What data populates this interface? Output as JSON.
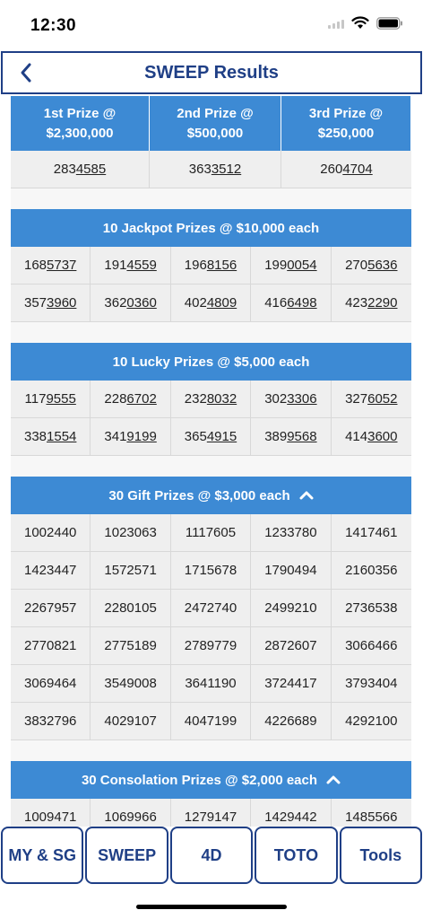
{
  "status_bar": {
    "time": "12:30"
  },
  "header": {
    "title": "SWEEP Results",
    "back_icon": "chevron-left-icon"
  },
  "top_prizes": [
    {
      "label_line1": "1st Prize @",
      "label_line2": "$2,300,000",
      "number_prefix": "283",
      "number_suffix": "4585"
    },
    {
      "label_line1": "2nd Prize @",
      "label_line2": "$500,000",
      "number_prefix": "363",
      "number_suffix": "3512"
    },
    {
      "label_line1": "3rd Prize @",
      "label_line2": "$250,000",
      "number_prefix": "260",
      "number_suffix": "4704"
    }
  ],
  "sections": [
    {
      "title": "10 Jackpot Prizes @ $10,000 each",
      "collapsible": false,
      "numbers": [
        [
          "168",
          "5737"
        ],
        [
          "191",
          "4559"
        ],
        [
          "196",
          "8156"
        ],
        [
          "199",
          "0054"
        ],
        [
          "270",
          "5636"
        ],
        [
          "357",
          "3960"
        ],
        [
          "362",
          "0360"
        ],
        [
          "402",
          "4809"
        ],
        [
          "416",
          "6498"
        ],
        [
          "423",
          "2290"
        ]
      ]
    },
    {
      "title": "10 Lucky Prizes @ $5,000 each",
      "collapsible": false,
      "numbers": [
        [
          "117",
          "9555"
        ],
        [
          "228",
          "6702"
        ],
        [
          "232",
          "8032"
        ],
        [
          "302",
          "3306"
        ],
        [
          "327",
          "6052"
        ],
        [
          "338",
          "1554"
        ],
        [
          "341",
          "9199"
        ],
        [
          "365",
          "4915"
        ],
        [
          "389",
          "9568"
        ],
        [
          "414",
          "3600"
        ]
      ]
    },
    {
      "title": "30 Gift Prizes @ $3,000 each",
      "collapsible": true,
      "numbers": [
        [
          "1002440",
          ""
        ],
        [
          "1023063",
          ""
        ],
        [
          "1117605",
          ""
        ],
        [
          "1233780",
          ""
        ],
        [
          "1417461",
          ""
        ],
        [
          "1423447",
          ""
        ],
        [
          "1572571",
          ""
        ],
        [
          "1715678",
          ""
        ],
        [
          "1790494",
          ""
        ],
        [
          "2160356",
          ""
        ],
        [
          "2267957",
          ""
        ],
        [
          "2280105",
          ""
        ],
        [
          "2472740",
          ""
        ],
        [
          "2499210",
          ""
        ],
        [
          "2736538",
          ""
        ],
        [
          "2770821",
          ""
        ],
        [
          "2775189",
          ""
        ],
        [
          "2789779",
          ""
        ],
        [
          "2872607",
          ""
        ],
        [
          "3066466",
          ""
        ],
        [
          "3069464",
          ""
        ],
        [
          "3549008",
          ""
        ],
        [
          "3641190",
          ""
        ],
        [
          "3724417",
          ""
        ],
        [
          "3793404",
          ""
        ],
        [
          "3832796",
          ""
        ],
        [
          "4029107",
          ""
        ],
        [
          "4047199",
          ""
        ],
        [
          "4226689",
          ""
        ],
        [
          "4292100",
          ""
        ]
      ]
    },
    {
      "title": "30 Consolation Prizes @ $2,000 each",
      "collapsible": true,
      "numbers": [
        [
          "1009471",
          ""
        ],
        [
          "1069966",
          ""
        ],
        [
          "1279147",
          ""
        ],
        [
          "1429442",
          ""
        ],
        [
          "1485566",
          ""
        ]
      ]
    }
  ],
  "tabs": [
    {
      "label": "MY & SG"
    },
    {
      "label": "SWEEP"
    },
    {
      "label": "4D"
    },
    {
      "label": "TOTO"
    },
    {
      "label": "Tools"
    }
  ]
}
